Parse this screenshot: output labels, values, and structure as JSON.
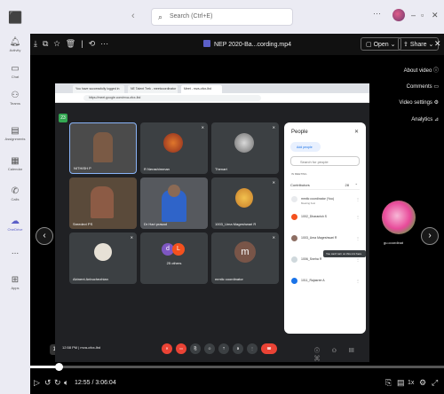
{
  "teams": {
    "search_placeholder": "Search (Ctrl+E)",
    "rail": [
      {
        "label": "Activity",
        "icon": "bell-icon"
      },
      {
        "label": "Chat",
        "icon": "chat-icon"
      },
      {
        "label": "Teams",
        "icon": "teams-icon"
      },
      {
        "label": "Assignments",
        "icon": "assignments-icon"
      },
      {
        "label": "Calendar",
        "icon": "calendar-icon"
      },
      {
        "label": "Calls",
        "icon": "phone-icon"
      },
      {
        "label": "OneDrive",
        "icon": "cloud-icon"
      },
      {
        "label": "...",
        "icon": "more-icon"
      },
      {
        "label": "Apps",
        "icon": "apps-icon"
      }
    ]
  },
  "player": {
    "file_name": "NEP 2020-Ba...cording.mp4",
    "open_label": "Open",
    "share_label": "Share",
    "side_menu": [
      {
        "label": "About video"
      },
      {
        "label": "Comments"
      },
      {
        "label": "Video settings"
      },
      {
        "label": "Analytics"
      }
    ],
    "time_display": "12:55 / 3:06:04",
    "hover_time": "12:55",
    "progress_fraction": 0.069
  },
  "meet": {
    "url": "https://meet.google.com/mva-ofcx-lbd",
    "tabs": [
      "You have successfully logged in",
      "NE Talent Trek - meetcoordinator",
      "Meet - mva-ofcx-lbd"
    ],
    "tiles": [
      {
        "name": "NITHISH P",
        "color": "#4a4a4a"
      },
      {
        "name": "R Nerashimman",
        "color": "#3c4043"
      },
      {
        "name": "Thenart",
        "color": "#3c4043"
      },
      {
        "name": "Sreedevi PS",
        "color": "#5a4a3a"
      },
      {
        "name": "Dr Hari prasad",
        "color": "#4a4e54"
      },
      {
        "name": "1003_Uma Mageshwari R",
        "color": "#3c4043"
      },
      {
        "name": "Abinent Anbuchezhian",
        "color": "#3c4043"
      },
      {
        "name": "25 others",
        "color": "#3c4043"
      },
      {
        "name": "mmtlc coordinator",
        "color": "#3c4043"
      }
    ],
    "people": {
      "title": "People",
      "add_people": "Add people",
      "search_placeholder": "Search for people",
      "in_meeting": "IN MEETING",
      "contributors": "Contributors",
      "contributors_count": "28",
      "rows": [
        {
          "name": "mmtlc coordinator (You)",
          "sub": "Meeting host",
          "color": "#e8eaed"
        },
        {
          "name": "1002_Dharanish S",
          "sub": "",
          "color": "#f4511e"
        },
        {
          "name": "1003_Uma Mageshwari R",
          "sub": "",
          "color": "#8d6e63"
        },
        {
          "name": "1006_Sneha R",
          "sub": "",
          "color": "#cfd8dc"
        },
        {
          "name": "1011_Rajasree A",
          "sub": "",
          "color": "#1a73e8"
        }
      ],
      "tooltip": "You can't turn on this mic here"
    },
    "bottom_time": "12:58 PM | mva-ofcx-lbd"
  },
  "pip_label": "gu.coordinat"
}
